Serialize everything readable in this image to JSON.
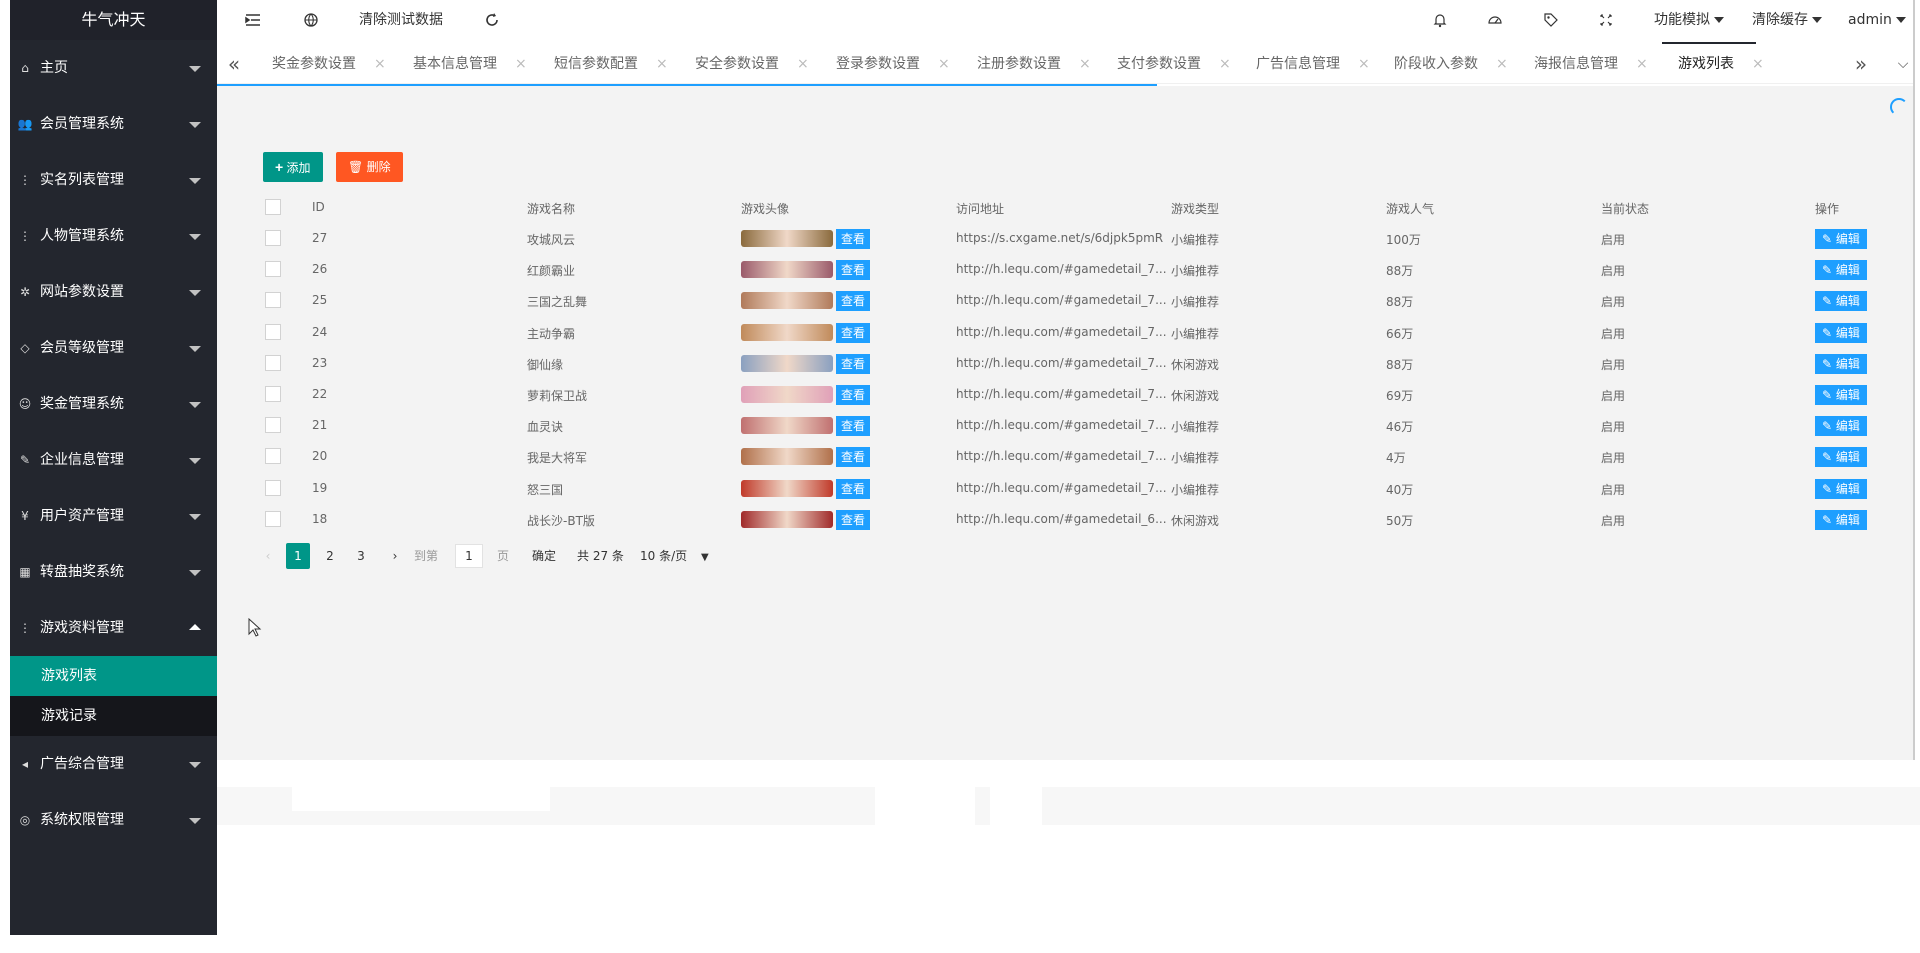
{
  "sidebar": {
    "logo": "牛气冲天",
    "items": [
      {
        "label": "主页",
        "icon": "home-icon",
        "glyph": "⌂"
      },
      {
        "label": "会员管理系统",
        "icon": "users-icon",
        "glyph": "👥"
      },
      {
        "label": "实名列表管理",
        "icon": "dots-icon",
        "glyph": "⋮"
      },
      {
        "label": "人物管理系统",
        "icon": "dots-icon",
        "glyph": "⋮"
      },
      {
        "label": "网站参数设置",
        "icon": "gear-icon",
        "glyph": "✲"
      },
      {
        "label": "会员等级管理",
        "icon": "diamond-icon",
        "glyph": "◇"
      },
      {
        "label": "奖金管理系统",
        "icon": "smile-icon",
        "glyph": "☺"
      },
      {
        "label": "企业信息管理",
        "icon": "edit-doc-icon",
        "glyph": "✎"
      },
      {
        "label": "用户资产管理",
        "icon": "yen-icon",
        "glyph": "¥"
      },
      {
        "label": "转盘抽奖系统",
        "icon": "apps-icon",
        "glyph": "▦"
      },
      {
        "label": "游戏资料管理",
        "icon": "dots-icon",
        "glyph": "⋮"
      },
      {
        "label": "广告综合管理",
        "icon": "speaker-icon",
        "glyph": "◂"
      },
      {
        "label": "系统权限管理",
        "icon": "shield-icon",
        "glyph": "◎"
      }
    ],
    "submenu": [
      {
        "label": "游戏列表"
      },
      {
        "label": "游戏记录"
      }
    ]
  },
  "header": {
    "clear_test_data": "清除测试数据",
    "feature_sim": "功能模拟",
    "clear_cache": "清除缓存",
    "user": "admin"
  },
  "tabs": [
    {
      "label": "奖金参数设置"
    },
    {
      "label": "基本信息管理"
    },
    {
      "label": "短信参数配置"
    },
    {
      "label": "安全参数设置"
    },
    {
      "label": "登录参数设置"
    },
    {
      "label": "注册参数设置"
    },
    {
      "label": "支付参数设置"
    },
    {
      "label": "广告信息管理"
    },
    {
      "label": "阶段收入参数"
    },
    {
      "label": "海报信息管理"
    },
    {
      "label": "游戏列表"
    }
  ],
  "toolbar": {
    "add_label": "添加",
    "delete_label": "删除"
  },
  "table": {
    "headers": [
      "ID",
      "游戏名称",
      "游戏头像",
      "访问地址",
      "游戏类型",
      "游戏人气",
      "当前状态",
      "操作"
    ],
    "view_label": "查看",
    "edit_label": "编辑",
    "rows": [
      {
        "id": "27",
        "name": "攻城风云",
        "url": "https://s.cxgame.net/s/6djpk5pmR",
        "type": "小编推荐",
        "popularity": "100万",
        "status": "启用",
        "thumb": "#8a6a3c"
      },
      {
        "id": "26",
        "name": "红颜霸业",
        "url": "http://h.lequ.com/#gamedetail_7...",
        "type": "小编推荐",
        "popularity": "88万",
        "status": "启用",
        "thumb": "#9a5a6a"
      },
      {
        "id": "25",
        "name": "三国之乱舞",
        "url": "http://h.lequ.com/#gamedetail_7...",
        "type": "小编推荐",
        "popularity": "88万",
        "status": "启用",
        "thumb": "#b07a5a"
      },
      {
        "id": "24",
        "name": "主动争霸",
        "url": "http://h.lequ.com/#gamedetail_7...",
        "type": "小编推荐",
        "popularity": "66万",
        "status": "启用",
        "thumb": "#c08a5a"
      },
      {
        "id": "23",
        "name": "御仙缘",
        "url": "http://h.lequ.com/#gamedetail_7...",
        "type": "休闲游戏",
        "popularity": "88万",
        "status": "启用",
        "thumb": "#8aa0c0"
      },
      {
        "id": "22",
        "name": "萝莉保卫战",
        "url": "http://h.lequ.com/#gamedetail_7...",
        "type": "休闲游戏",
        "popularity": "69万",
        "status": "启用",
        "thumb": "#e0a0b8"
      },
      {
        "id": "21",
        "name": "血灵诀",
        "url": "http://h.lequ.com/#gamedetail_7...",
        "type": "小编推荐",
        "popularity": "46万",
        "status": "启用",
        "thumb": "#c07070"
      },
      {
        "id": "20",
        "name": "我是大将军",
        "url": "http://h.lequ.com/#gamedetail_7...",
        "type": "小编推荐",
        "popularity": "4万",
        "status": "启用",
        "thumb": "#b0704a"
      },
      {
        "id": "19",
        "name": "怒三国",
        "url": "http://h.lequ.com/#gamedetail_7...",
        "type": "小编推荐",
        "popularity": "40万",
        "status": "启用",
        "thumb": "#c03a2a"
      },
      {
        "id": "18",
        "name": "战长沙-BT版",
        "url": "http://h.lequ.com/#gamedetail_6...",
        "type": "休闲游戏",
        "popularity": "50万",
        "status": "启用",
        "thumb": "#a02a2a"
      }
    ]
  },
  "pagination": {
    "pages": [
      "1",
      "2",
      "3"
    ],
    "goto_label": "到第",
    "goto_value": "1",
    "page_unit": "页",
    "confirm": "确定",
    "total": "共 27 条",
    "page_size": "10 条/页"
  },
  "colors": {
    "sidebar_bg": "#23262e",
    "accent": "#009688",
    "danger": "#ff5722",
    "info": "#1e9fff"
  }
}
